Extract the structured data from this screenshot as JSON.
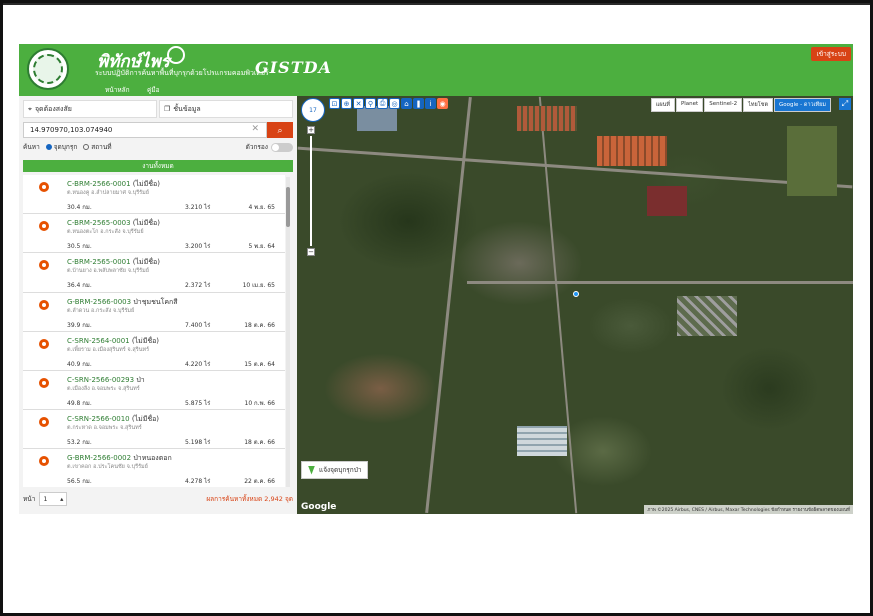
{
  "header": {
    "title": "พิทักษ์ไพร",
    "subtitle": "ระบบปฏิบัติการค้นหาพื้นที่บุกรุกด้วยโปรแกรมคอมพิวเตอร์",
    "partner": "GISTDA",
    "login_label": "เข้าสู่ระบบ",
    "nav": [
      {
        "label": "หน้าหลัก",
        "active": true
      },
      {
        "label": "คู่มือ",
        "active": false
      }
    ]
  },
  "left": {
    "mode_location": "จุดต้องสงสัย",
    "mode_data": "ชั้นข้อมูล",
    "search_value": "14.970970,103.074940",
    "filter_label": "ค้นหา",
    "filter_option_1": "จุดบุกรุก",
    "filter_option_2": "สถานที่",
    "toggle_label": "ตัวกรอง",
    "all_label": "งานทั้งหมด",
    "items": [
      {
        "code": "C-BRM-2566-0001",
        "name": "(ไม่มีชื่อ)",
        "addr": "ต.หนองคู อ.ลำปลายมาศ จ.บุรีรัมย์",
        "dist": "30.4 กม.",
        "area": "3.210 ไร่",
        "date": "4 พ.ย. 65"
      },
      {
        "code": "C-BRM-2565-0003",
        "name": "(ไม่มีชื่อ)",
        "addr": "ต.หนองตะโก อ.กระสัง จ.บุรีรัมย์",
        "dist": "30.5 กม.",
        "area": "3.200 ไร่",
        "date": "5 พ.ย. 64"
      },
      {
        "code": "C-BRM-2565-0001",
        "name": "(ไม่มีชื่อ)",
        "addr": "ต.บ้านยาง อ.พลับพลาชัย จ.บุรีรัมย์",
        "dist": "36.4 กม.",
        "area": "2.372 ไร่",
        "date": "10 เม.ย. 65"
      },
      {
        "code": "G-BRM-2566-0003",
        "name": "ป่าชุมชนโคกสี",
        "addr": "ต.ลำดวน อ.กระสัง จ.บุรีรัมย์",
        "dist": "39.9 กม.",
        "area": "7.400 ไร่",
        "date": "18 ต.ค. 66"
      },
      {
        "code": "C-SRN-2564-0001",
        "name": "(ไม่มีชื่อ)",
        "addr": "ต.เพี้ยราม อ.เมืองสุรินทร์ จ.สุรินทร์",
        "dist": "40.9 กม.",
        "area": "4.220 ไร่",
        "date": "15 ต.ค. 64"
      },
      {
        "code": "C-SRN-2566-00293",
        "name": "ป่า",
        "addr": "ต.เมืองลีง อ.จอมพระ จ.สุรินทร์",
        "dist": "49.8 กม.",
        "area": "5.875 ไร่",
        "date": "10 ก.พ. 66"
      },
      {
        "code": "C-SRN-2566-0010",
        "name": "(ไม่มีชื่อ)",
        "addr": "ต.กระหาด อ.จอมพระ จ.สุรินทร์",
        "dist": "53.2 กม.",
        "area": "5.198 ไร่",
        "date": "18 ต.ค. 66"
      },
      {
        "code": "G-BRM-2566-0002",
        "name": "ป่าหนองตอก",
        "addr": "ต.เขาคอก อ.ประโคนชัย จ.บุรีรัมย์",
        "dist": "56.5 กม.",
        "area": "4.278 ไร่",
        "date": "22 ต.ค. 66"
      }
    ],
    "pager_label": "หน้า",
    "pager_value": "1",
    "result_count": "ผลการค้นหาทั้งหมด 2,942 จุด"
  },
  "map": {
    "zoom_level": "17",
    "layers": [
      {
        "label": "แผนที่",
        "on": false
      },
      {
        "label": "Planet",
        "on": false
      },
      {
        "label": "Sentinel-2",
        "on": false
      },
      {
        "label": "ไทยโชต",
        "on": false
      },
      {
        "label": "Google - ดาวเทียม",
        "on": true
      }
    ],
    "my_location_label": "แจ้งจุดบุกรุกป่า",
    "google_label": "Google",
    "attribution": "ภาพ ©2025 Airbus, CNES / Airbus, Maxar Technologies   ข้อกำหนด   รายงานข้อผิดพลาดของแผนที่"
  }
}
